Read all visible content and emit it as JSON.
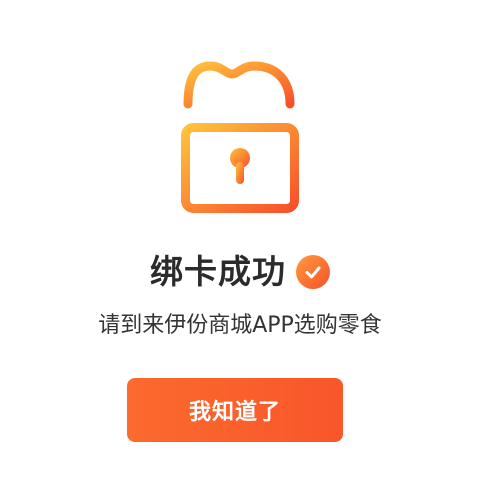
{
  "result": {
    "title": "绑卡成功",
    "subtitle": "请到来伊份商城APP选购零食",
    "button_label": "我知道了"
  },
  "icons": {
    "lock": "unlocked-padlock-icon",
    "badge": "check-circle-icon"
  },
  "colors": {
    "accent_start": "#ffb23a",
    "accent_end": "#f7532c",
    "button": "#fa5f2c",
    "title_text": "#2b2b2b",
    "body_text": "#333333"
  }
}
